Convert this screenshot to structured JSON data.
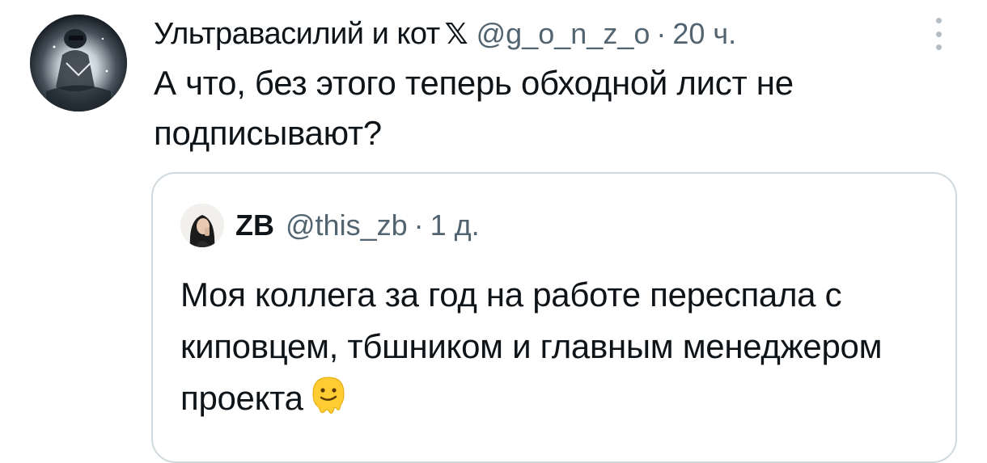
{
  "tweet": {
    "display_name": "Ультравасилий и кот",
    "badge": "𝕏",
    "handle": "@g_o_n_z_o",
    "separator": "·",
    "time": "20 ч.",
    "text": "А что, без этого теперь обходной лист не подписывают?",
    "more_icon": "more-vertical-icon"
  },
  "quote": {
    "display_name": "ZB",
    "handle": "@this_zb",
    "separator": "·",
    "time": "1 д.",
    "text": "Моя коллега за год на работе переспала с киповцем, тбшником и главным менеджером проекта",
    "emoji": "melting-face-icon"
  },
  "colors": {
    "text_primary": "#0f1419",
    "text_secondary": "#536471",
    "border": "#cfd9de",
    "emoji_yellow": "#ffcc33"
  }
}
